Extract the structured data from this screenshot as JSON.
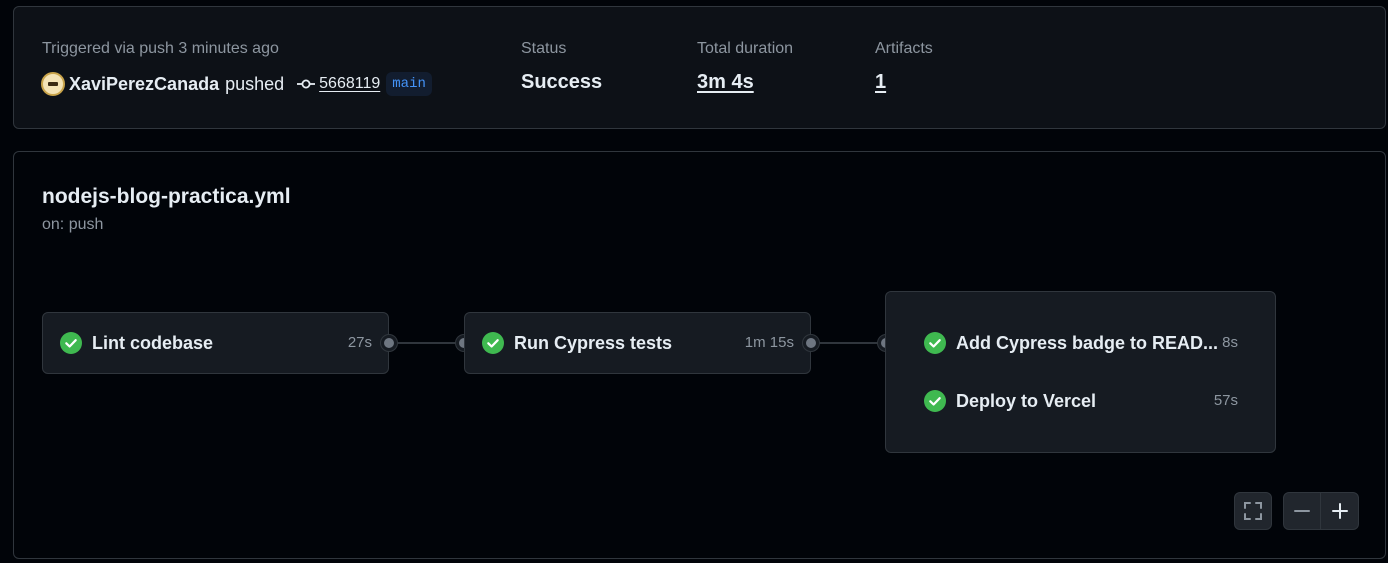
{
  "summary": {
    "trigger_text": "Triggered via push 3 minutes ago",
    "actor": "XaviPerezCanada",
    "action": "pushed",
    "commit_sha": "5668119",
    "branch": "main",
    "status_label": "Status",
    "status_value": "Success",
    "duration_label": "Total duration",
    "duration_value": "3m 4s",
    "artifacts_label": "Artifacts",
    "artifacts_value": "1"
  },
  "workflow": {
    "name": "nodejs-blog-practica.yml",
    "trigger": "on: push"
  },
  "jobs": [
    {
      "name": "Lint codebase",
      "duration": "27s",
      "status": "success"
    },
    {
      "name": "Run Cypress tests",
      "duration": "1m 15s",
      "status": "success"
    }
  ],
  "job_group": [
    {
      "name": "Add Cypress badge to READ...",
      "duration": "8s",
      "status": "success"
    },
    {
      "name": "Deploy to Vercel",
      "duration": "57s",
      "status": "success"
    }
  ],
  "controls": {
    "fullscreen_icon": "fullscreen-icon",
    "zoom_out_icon": "minus-icon",
    "zoom_in_icon": "plus-icon"
  },
  "colors": {
    "success": "#3fb950",
    "branch": "#4493f8",
    "background": "#010409",
    "panel": "#0d1117",
    "card": "#161b22",
    "border": "#30363d"
  }
}
